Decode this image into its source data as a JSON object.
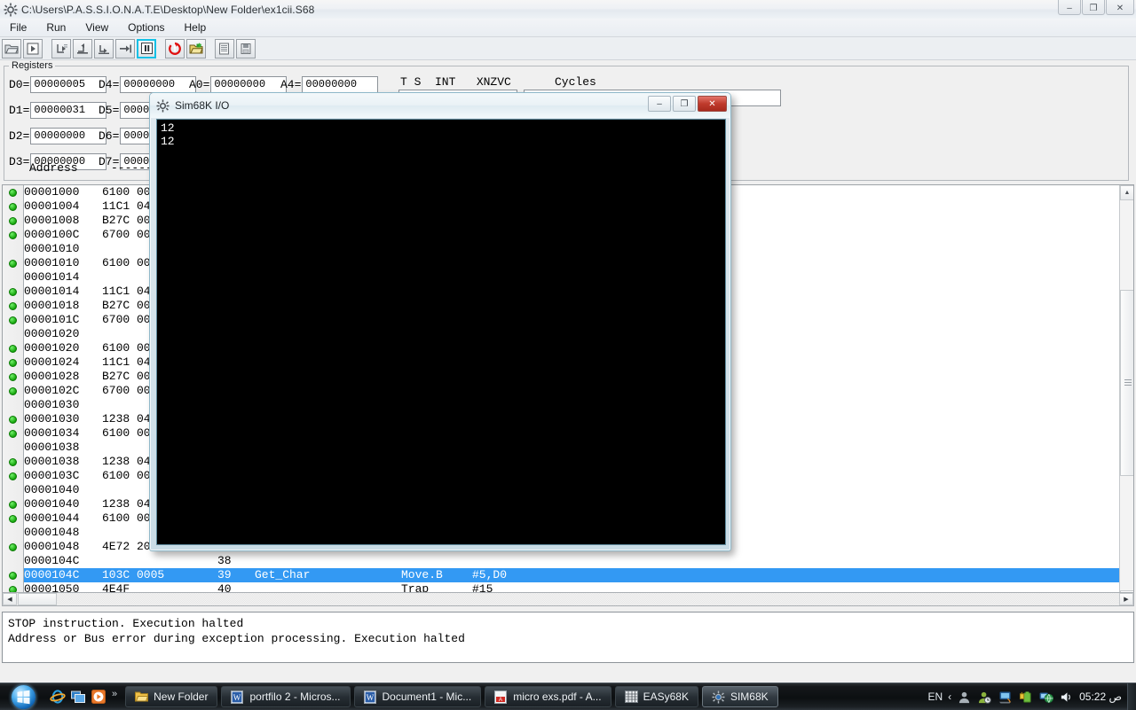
{
  "window": {
    "title": "C:\\Users\\P.A.S.S.I.O.N.A.T.E\\Desktop\\New Folder\\ex1cii.S68",
    "icon": "gear-icon",
    "minimize": "–",
    "maximize": "❐",
    "close": "✕"
  },
  "menu": {
    "items": [
      {
        "label": "File"
      },
      {
        "label": "Run"
      },
      {
        "label": "View"
      },
      {
        "label": "Options"
      },
      {
        "label": "Help"
      }
    ]
  },
  "toolbar": {
    "buttons": [
      {
        "name": "open-file-button",
        "icon": "open-folder-icon"
      },
      {
        "name": "run-button",
        "icon": "play-in-box-icon"
      },
      {
        "name": "step-into-button",
        "icon": "step-into-icon"
      },
      {
        "name": "step-over-button",
        "icon": "step-over-icon"
      },
      {
        "name": "step-out-button",
        "icon": "step-out-icon"
      },
      {
        "name": "run-to-cursor-button",
        "icon": "run-to-cursor-icon"
      },
      {
        "name": "pause-button",
        "icon": "pause-icon",
        "active": true
      },
      {
        "name": "reset-button",
        "icon": "reset-red-icon"
      },
      {
        "name": "reload-file-button",
        "icon": "open-folder-green-icon"
      },
      {
        "name": "memory-view-button",
        "icon": "memory-list-icon"
      },
      {
        "name": "save-state-button",
        "icon": "save-disk-icon"
      }
    ]
  },
  "registers": {
    "legend": "Registers",
    "data_left": [
      {
        "label": "D0=",
        "value": "00000005"
      },
      {
        "label": "D1=",
        "value": "00000031"
      },
      {
        "label": "D2=",
        "value": "00000000"
      },
      {
        "label": "D3=",
        "value": "00000000"
      }
    ],
    "data_right": [
      {
        "label": "D4=",
        "value": "00000000"
      },
      {
        "label": "D5=",
        "value": "00000000"
      },
      {
        "label": "D6=",
        "value": "00000000"
      },
      {
        "label": "D7=",
        "value": "00000000"
      }
    ],
    "addr_left": [
      {
        "label": "A0=",
        "value": "00000000"
      }
    ],
    "addr_right": [
      {
        "label": "A4=",
        "value": "00000000"
      }
    ],
    "flags_header": "T S  INT   XNZVC",
    "cycles_header": "Cycles",
    "address_label": "Address",
    "address_dashes": "---------"
  },
  "disassembly": {
    "rows": [
      {
        "bp": true,
        "addr": "00001000",
        "hex": "6100 004",
        "num": "",
        "label": "",
        "op": "",
        "args": ""
      },
      {
        "bp": true,
        "addr": "00001004",
        "hex": "11C1 040",
        "num": "",
        "label": "",
        "op": "",
        "args": ""
      },
      {
        "bp": true,
        "addr": "00001008",
        "hex": "B27C 000",
        "num": "",
        "label": "",
        "op": "",
        "args": ""
      },
      {
        "bp": true,
        "addr": "0000100C",
        "hex": "6700 002",
        "num": "",
        "label": "",
        "op": "",
        "args": ""
      },
      {
        "bp": false,
        "addr": "00001010",
        "hex": "",
        "num": "",
        "label": "",
        "op": "",
        "args": ""
      },
      {
        "bp": true,
        "addr": "00001010",
        "hex": "6100 003",
        "num": "",
        "label": "",
        "op": "",
        "args": ""
      },
      {
        "bp": false,
        "addr": "00001014",
        "hex": "",
        "num": "",
        "label": "",
        "op": "",
        "args": ""
      },
      {
        "bp": true,
        "addr": "00001014",
        "hex": "11C1 040",
        "num": "",
        "label": "",
        "op": "",
        "args": ""
      },
      {
        "bp": true,
        "addr": "00001018",
        "hex": "B27C 000",
        "num": "",
        "label": "",
        "op": "",
        "args": ""
      },
      {
        "bp": true,
        "addr": "0000101C",
        "hex": "6700 001",
        "num": "",
        "label": "",
        "op": "",
        "args": ""
      },
      {
        "bp": false,
        "addr": "00001020",
        "hex": "",
        "num": "",
        "label": "",
        "op": "",
        "args": ""
      },
      {
        "bp": true,
        "addr": "00001020",
        "hex": "6100 002",
        "num": "",
        "label": "",
        "op": "",
        "args": ""
      },
      {
        "bp": true,
        "addr": "00001024",
        "hex": "11C1 040",
        "num": "",
        "label": "",
        "op": "",
        "args": ""
      },
      {
        "bp": true,
        "addr": "00001028",
        "hex": "B27C 000",
        "num": "",
        "label": "",
        "op": "",
        "args": ""
      },
      {
        "bp": true,
        "addr": "0000102C",
        "hex": "6700 000",
        "num": "",
        "label": "",
        "op": "",
        "args": ""
      },
      {
        "bp": false,
        "addr": "00001030",
        "hex": "",
        "num": "",
        "label": "",
        "op": "",
        "args": ""
      },
      {
        "bp": true,
        "addr": "00001030",
        "hex": "1238 040",
        "num": "",
        "label": "",
        "op": "",
        "args": ""
      },
      {
        "bp": true,
        "addr": "00001034",
        "hex": "6100 001",
        "num": "",
        "label": "",
        "op": "",
        "args": ""
      },
      {
        "bp": false,
        "addr": "00001038",
        "hex": "",
        "num": "",
        "label": "",
        "op": "",
        "args": ""
      },
      {
        "bp": true,
        "addr": "00001038",
        "hex": "1238 040",
        "num": "",
        "label": "",
        "op": "",
        "args": ""
      },
      {
        "bp": true,
        "addr": "0000103C",
        "hex": "6100 001",
        "num": "",
        "label": "",
        "op": "",
        "args": ""
      },
      {
        "bp": false,
        "addr": "00001040",
        "hex": "",
        "num": "",
        "label": "",
        "op": "",
        "args": ""
      },
      {
        "bp": true,
        "addr": "00001040",
        "hex": "1238 040",
        "num": "",
        "label": "",
        "op": "",
        "args": ""
      },
      {
        "bp": true,
        "addr": "00001044",
        "hex": "6100 000",
        "num": "",
        "label": "",
        "op": "",
        "args": ""
      },
      {
        "bp": false,
        "addr": "00001048",
        "hex": "",
        "num": "",
        "label": "",
        "op": "",
        "args": ""
      },
      {
        "bp": true,
        "addr": "00001048",
        "hex": "4E72 200",
        "num": "",
        "label": "",
        "op": "",
        "args": ""
      },
      {
        "bp": false,
        "addr": "0000104C",
        "hex": "",
        "num": "38",
        "label": "",
        "op": "",
        "args": ""
      },
      {
        "bp": true,
        "addr": "0000104C",
        "hex": "103C 0005",
        "num": "39",
        "label": "Get_Char",
        "op": "Move.B",
        "args": "#5,D0",
        "selected": true
      },
      {
        "bp": true,
        "addr": "00001050",
        "hex": "4E4F",
        "num": "40",
        "label": "",
        "op": "Trap",
        "args": "#15"
      }
    ]
  },
  "io_window": {
    "title": "Sim68K I/O",
    "icon": "gear-icon",
    "minimize": "–",
    "maximize": "❐",
    "close": "✕",
    "console_lines": [
      "12",
      "12"
    ]
  },
  "messages": {
    "lines": [
      "STOP instruction. Execution halted",
      "Address or Bus error during exception processing. Execution halted"
    ]
  },
  "taskbar": {
    "start": "start-orb",
    "quick_launch": [
      {
        "name": "internet-explorer-icon"
      },
      {
        "name": "switch-windows-icon"
      },
      {
        "name": "media-player-icon"
      }
    ],
    "overflow": "»",
    "tasks": [
      {
        "label": "New Folder",
        "icon": "folder-icon",
        "active": false
      },
      {
        "label": "portfilo 2 - Micros...",
        "icon": "word-doc-icon",
        "active": false
      },
      {
        "label": "Document1 - Mic...",
        "icon": "word-doc-icon",
        "active": false
      },
      {
        "label": "micro exs.pdf - A...",
        "icon": "pdf-icon",
        "active": false
      },
      {
        "label": "EASy68K",
        "icon": "easy68k-icon",
        "active": false
      },
      {
        "label": "SIM68K",
        "icon": "sim68k-icon",
        "active": true
      }
    ],
    "tray": {
      "language": "EN",
      "chevron": "‹",
      "icons": [
        {
          "name": "user-account-icon"
        },
        {
          "name": "user-clock-icon"
        },
        {
          "name": "network-monitor-icon"
        },
        {
          "name": "battery-plug-icon"
        },
        {
          "name": "network-globe-icon"
        },
        {
          "name": "volume-icon"
        }
      ],
      "clock": "05:22 ص"
    }
  },
  "colors": {
    "selection": "#3399f3",
    "breakpoint": "#16a60d",
    "accent_toolbar": "#13c0e6",
    "console_bg": "#000000",
    "window_bg": "#f0f0f0"
  }
}
